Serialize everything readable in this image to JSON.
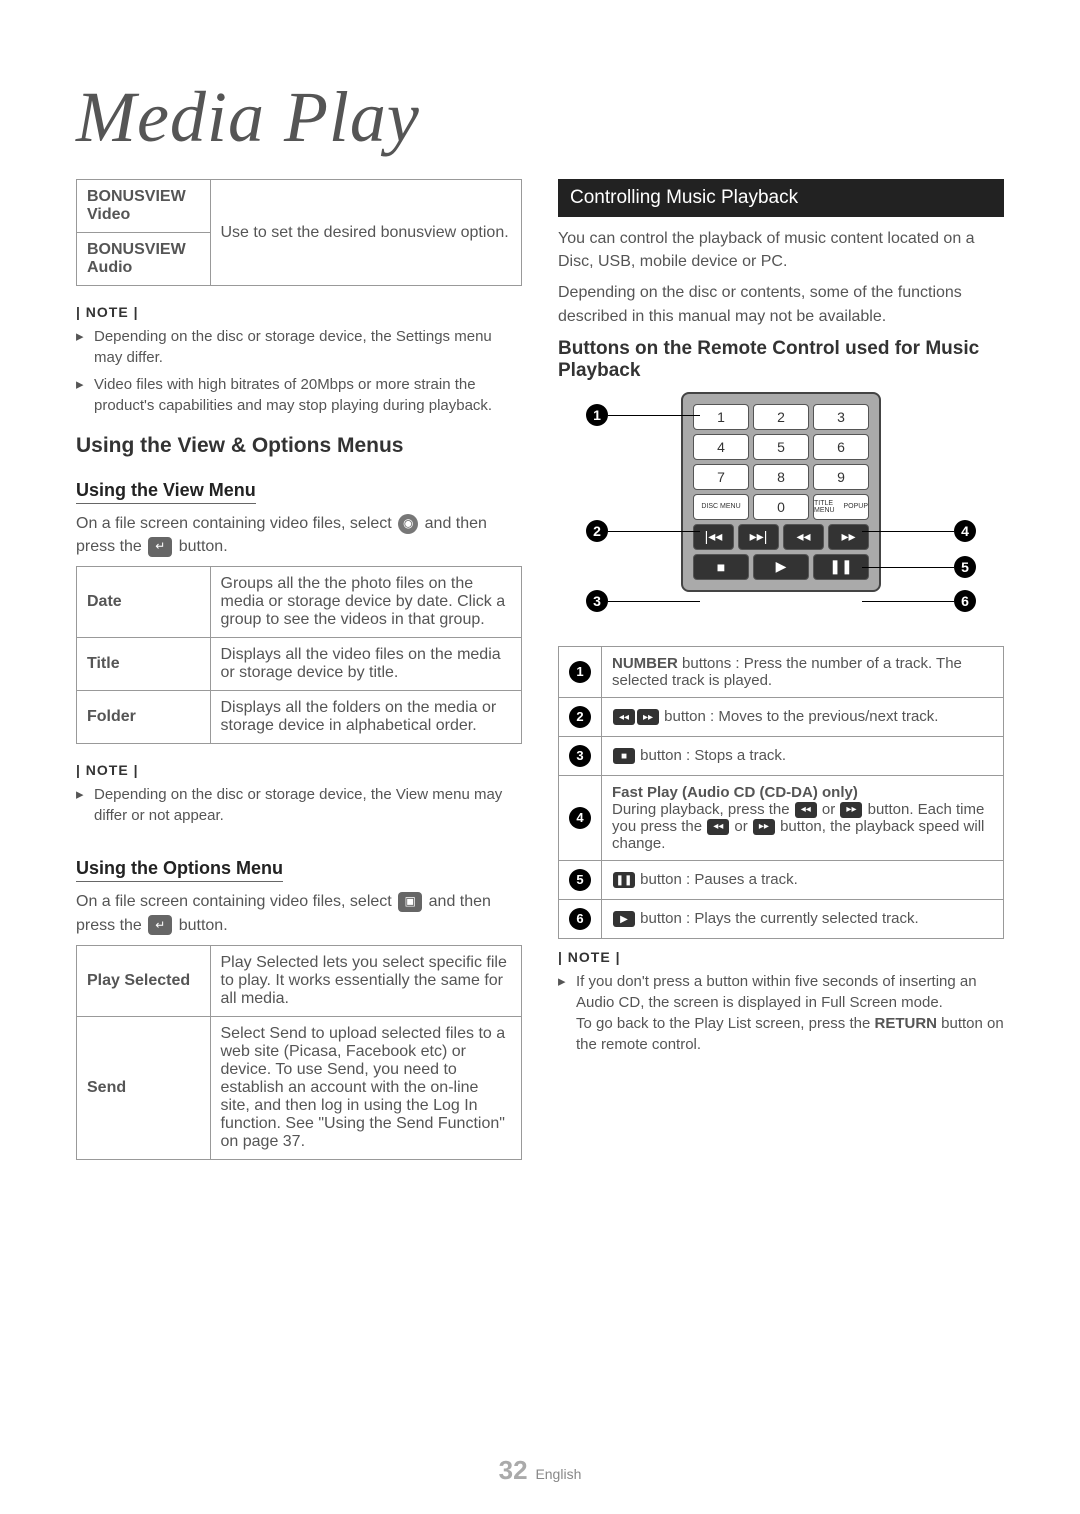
{
  "page_title": "Media Play",
  "bonusview_table": {
    "row1": "BONUSVIEW Video",
    "row2": "BONUSVIEW Audio",
    "desc": "Use to set the desired bonusview option."
  },
  "note_label": "| NOTE |",
  "left_notes": [
    "Depending on the disc or storage device, the Settings menu may differ.",
    "Video files with high bitrates of 20Mbps or more strain the product's capabilities and may stop playing during playback."
  ],
  "section1": "Using the View & Options Menus",
  "view_menu": {
    "header": "Using the View Menu",
    "intro_a": "On a file screen containing video files, select",
    "intro_b": "and then press the",
    "intro_c": "button.",
    "rows": [
      {
        "label": "Date",
        "desc": "Groups all the the photo files on the media or storage device by date. Click a group to see the videos in that group."
      },
      {
        "label": "Title",
        "desc": "Displays all the video files on the media or storage device by title."
      },
      {
        "label": "Folder",
        "desc": "Displays all the folders on the media or storage device in alphabetical order."
      }
    ]
  },
  "view_note": [
    "Depending on the disc or storage device, the View menu may differ or not appear."
  ],
  "options_menu": {
    "header": "Using the Options Menu",
    "intro_a": "On a file screen containing video files, select",
    "intro_b": "and then press the",
    "intro_c": "button.",
    "rows": [
      {
        "label": "Play Selected",
        "desc": "Play Selected lets you select specific file to play. It works essentially the same for all media."
      },
      {
        "label": "Send",
        "desc": "Select Send to upload selected files to a web site (Picasa, Facebook etc) or device. To use Send, you need to establish an account with the on-line site, and then log in using the Log In function. See \"Using the Send Function\" on page 37."
      }
    ]
  },
  "music_header": "Controlling Music Playback",
  "music_intro1": "You can control the playback of music content located on a Disc, USB, mobile device or PC.",
  "music_intro2": "Depending on the disc or contents, some of the functions described in this manual may not be available.",
  "remote_header": "Buttons on the Remote Control used for Music Playback",
  "remote_keys": {
    "k1": "1",
    "k2": "2",
    "k3": "3",
    "k4": "4",
    "k5": "5",
    "k6": "6",
    "k7": "7",
    "k8": "8",
    "k9": "9",
    "dm": "DISC MENU",
    "k0": "0",
    "pu": "POPUP",
    "tm": "TITLE MENU"
  },
  "callout_table": [
    {
      "n": "1",
      "text_a": "NUMBER",
      "text_b": " buttons : Press the number of a track. The selected track is played."
    },
    {
      "n": "2",
      "icon1": "◂◂",
      "icon2": "▸▸",
      "text": " button : Moves to the previous/next track."
    },
    {
      "n": "3",
      "icon": "■",
      "text": " button : Stops a track."
    },
    {
      "n": "4",
      "bold": "Fast Play (Audio CD (CD-DA) only)",
      "text_a": "During playback, press the ",
      "icon1": "◂◂",
      "mid": " or ",
      "icon2": "▸▸",
      "text_b": " button. Each time you press the ",
      "icon3": "◂◂",
      "mid2": " or ",
      "icon4": "▸▸",
      "text_c": " button, the playback speed will change."
    },
    {
      "n": "5",
      "icon": "❚❚",
      "text": " button : Pauses a track."
    },
    {
      "n": "6",
      "icon": "▶",
      "text": " button : Plays the currently selected track."
    }
  ],
  "right_note_a": "If you don't press a button within five seconds of inserting an Audio CD, the screen is displayed in Full Screen mode.",
  "right_note_b": "To go back to the Play List screen, press the ",
  "right_note_bold": "RETURN",
  "right_note_c": " button on the remote control.",
  "footer_page": "32",
  "footer_lang": "English"
}
